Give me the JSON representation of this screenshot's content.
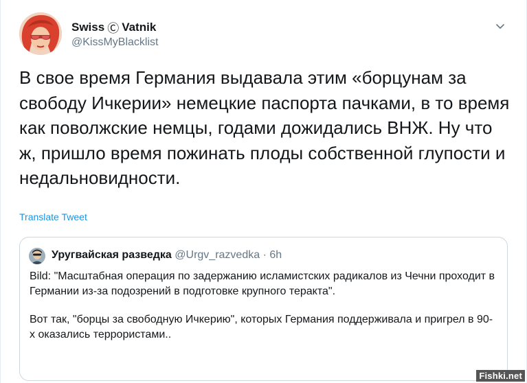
{
  "author": {
    "display_name_first": "Swiss",
    "display_name_mid": "Ⓒ",
    "display_name_last": "Vatnik",
    "handle": "@KissMyBlacklist",
    "avatar_icon": "avatar-cartoon-woman-red-hair-sunglasses"
  },
  "tweet": {
    "text": "В свое время Германия выдавала этим «борцунам за свободу Ичкерии» немецкие паспорта пачками, в то время как поволжские немцы, годами дожидались ВНЖ. Ну что ж, пришло время пожинать плоды собственной глупости и недальновидности.",
    "translate_label": "Translate Tweet",
    "menu_icon": "chevron-down-icon"
  },
  "quoted_tweet": {
    "name": "Уругвайская разведка",
    "handle": "@Urgv_razvedka",
    "separator": "·",
    "time": "6h",
    "paragraphs": [
      "Bild: \"Масштабная операция по задержанию исламистских радикалов из Чечни проходит в Германии из-за подозрений в подготовке крупного теракта\".",
      "Вот так, \"борцы за свободную Ичкерию\", которых Германия поддерживала и пригрел в 90-х оказались террористами.."
    ]
  },
  "watermark": "Fishki.net",
  "colors": {
    "link": "#1b95e0",
    "secondary_text": "#657786",
    "border": "#ccd6dd"
  }
}
